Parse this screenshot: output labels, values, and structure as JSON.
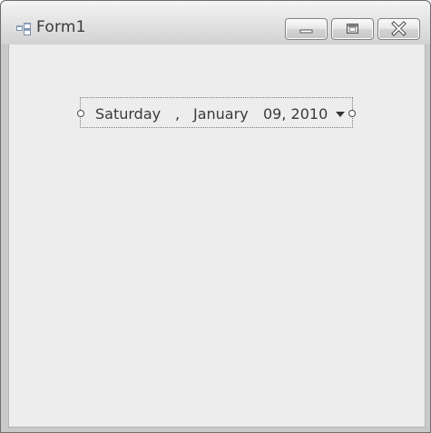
{
  "window": {
    "title": "Form1",
    "icon": "form-app-icon"
  },
  "title_buttons": {
    "minimize_icon": "minimize-icon",
    "maximize_icon": "maximize-icon",
    "close_icon": "close-icon"
  },
  "date_picker": {
    "weekday": "Saturday",
    "separator1": ",",
    "month": "January",
    "day_year": "09, 2010",
    "dropdown_icon": "chevron-down-icon"
  },
  "colors": {
    "client_background": "#ededed",
    "title_text": "#3a3a3a"
  }
}
